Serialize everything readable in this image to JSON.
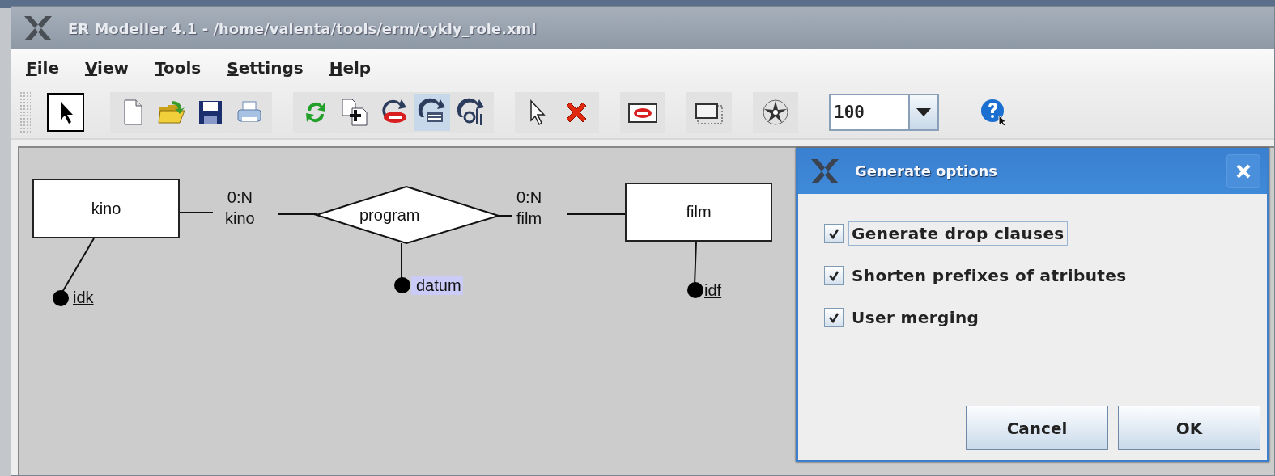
{
  "window": {
    "title": "ER Modeller 4.1 - /home/valenta/tools/erm/cykly_role.xml"
  },
  "menu": [
    {
      "label": "File"
    },
    {
      "label": "View"
    },
    {
      "label": "Tools"
    },
    {
      "label": "Settings"
    },
    {
      "label": "Help"
    }
  ],
  "toolbar": {
    "groups": [
      {
        "kind": "plain",
        "items": [
          {
            "kind": "pointer",
            "selected": true
          }
        ]
      },
      {
        "kind": "panel",
        "items": [
          {
            "kind": "new",
            "selected": false
          },
          {
            "kind": "open",
            "selected": false
          },
          {
            "kind": "save",
            "selected": false
          },
          {
            "kind": "print",
            "selected": false
          }
        ]
      },
      {
        "kind": "panel",
        "items": [
          {
            "kind": "refresh",
            "selected": false
          },
          {
            "kind": "add",
            "selected": false
          },
          {
            "kind": "erase",
            "selected": false
          },
          {
            "kind": "sql",
            "selected": true
          },
          {
            "kind": "obj",
            "selected": false
          }
        ]
      },
      {
        "kind": "panel",
        "items": [
          {
            "kind": "arrow",
            "selected": false
          },
          {
            "kind": "delete",
            "selected": false
          }
        ]
      },
      {
        "kind": "panel",
        "items": [
          {
            "kind": "entity",
            "selected": false
          }
        ]
      },
      {
        "kind": "panel",
        "items": [
          {
            "kind": "region",
            "selected": false
          }
        ]
      },
      {
        "kind": "panel",
        "items": [
          {
            "kind": "wheel",
            "selected": false
          }
        ]
      },
      {
        "kind": "combo",
        "value": "100"
      },
      {
        "kind": "plain",
        "items": [
          {
            "kind": "help",
            "selected": false
          }
        ]
      }
    ]
  },
  "diagram": {
    "entities": [
      {
        "name": "kino"
      },
      {
        "name": "film"
      }
    ],
    "relationship": {
      "name": "program"
    },
    "cardinalities": [
      {
        "ratio": "0:N",
        "role": "kino"
      },
      {
        "ratio": "0:N",
        "role": "film"
      }
    ],
    "attributes": [
      {
        "name": "idk",
        "key": true,
        "selected": false
      },
      {
        "name": "datum",
        "key": false,
        "selected": true
      },
      {
        "name": "idf",
        "key": true,
        "selected": false
      }
    ]
  },
  "dialog": {
    "title": "Generate options",
    "options": [
      {
        "label": "Generate drop clauses",
        "checked": true,
        "focused": true
      },
      {
        "label": "Shorten prefixes of atributes",
        "checked": true,
        "focused": false
      },
      {
        "label": "User merging",
        "checked": true,
        "focused": false
      }
    ],
    "buttons": [
      "Cancel",
      "OK"
    ]
  }
}
